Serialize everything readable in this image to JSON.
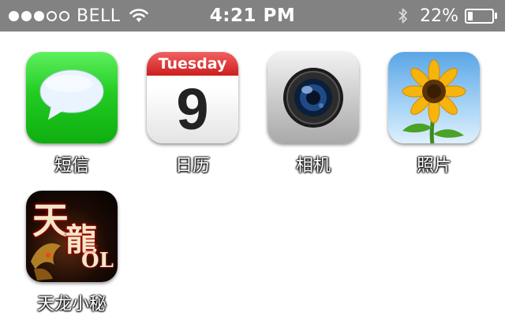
{
  "status_bar": {
    "signal_bars_filled": 3,
    "signal_bars_total": 5,
    "carrier": "BELL",
    "wifi_icon": "wifi-icon",
    "time": "4:21 PM",
    "bluetooth_icon": "bluetooth-icon",
    "battery_percent": "22%",
    "battery_level": 0.22
  },
  "apps": [
    {
      "id": "messages",
      "label": "短信",
      "icon": "speech-bubble-icon"
    },
    {
      "id": "calendar",
      "label": "日历",
      "icon": "calendar-icon",
      "weekday": "Tuesday",
      "day": "9"
    },
    {
      "id": "camera",
      "label": "相机",
      "icon": "camera-lens-icon"
    },
    {
      "id": "photos",
      "label": "照片",
      "icon": "sunflower-icon"
    },
    {
      "id": "tianlong",
      "label": "天龙小秘",
      "icon": "tianlong-game-icon"
    }
  ],
  "colors": {
    "status_bar_bg": "#828282",
    "messages_green": "#22cc22",
    "calendar_red": "#cc1e1e"
  }
}
